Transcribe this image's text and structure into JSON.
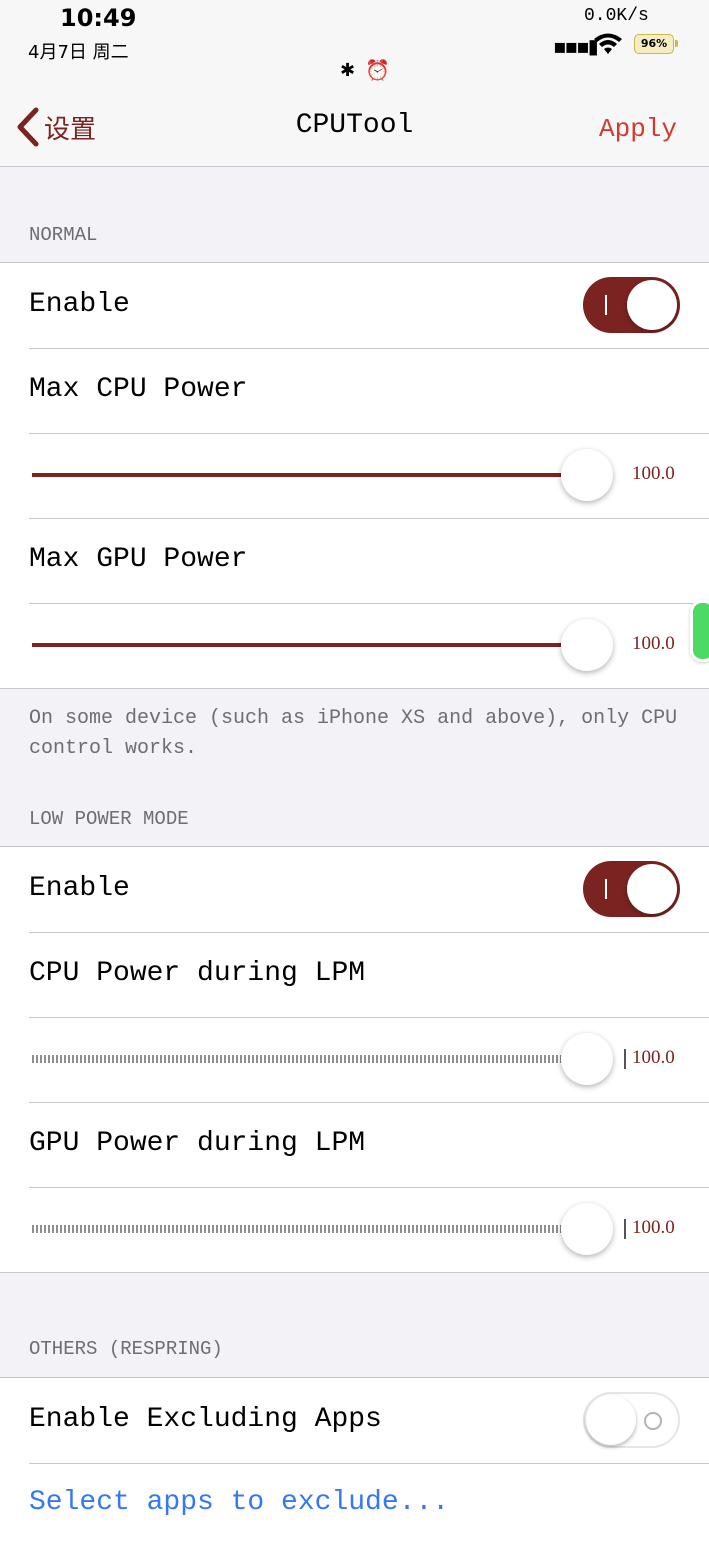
{
  "status_bar": {
    "time": "10:49",
    "date": "4月7日 周二",
    "net_speed": "0.0K/s",
    "battery": "96%"
  },
  "nav": {
    "back_label": "设置",
    "title": "CPUTool",
    "apply_label": "Apply"
  },
  "normal": {
    "header": "NORMAL",
    "enable_label": "Enable",
    "enable_on": true,
    "max_cpu_label": "Max CPU Power",
    "max_cpu_value": "100.0",
    "max_gpu_label": "Max GPU Power",
    "max_gpu_value": "100.0",
    "footer": "On some device (such as iPhone XS and above), only CPU control works."
  },
  "low_power": {
    "header": "LOW POWER MODE",
    "enable_label": "Enable",
    "enable_on": true,
    "cpu_label": "CPU Power during LPM",
    "cpu_value": "100.0",
    "gpu_label": "GPU Power during LPM",
    "gpu_value": "100.0"
  },
  "others": {
    "header": "OTHERS (RESPRING)",
    "exclude_label": "Enable Excluding Apps",
    "exclude_on": false,
    "select_link": "Select apps to exclude..."
  },
  "colors": {
    "accent": "#7a2320",
    "apply": "#d13a2e",
    "link": "#3478f6"
  }
}
